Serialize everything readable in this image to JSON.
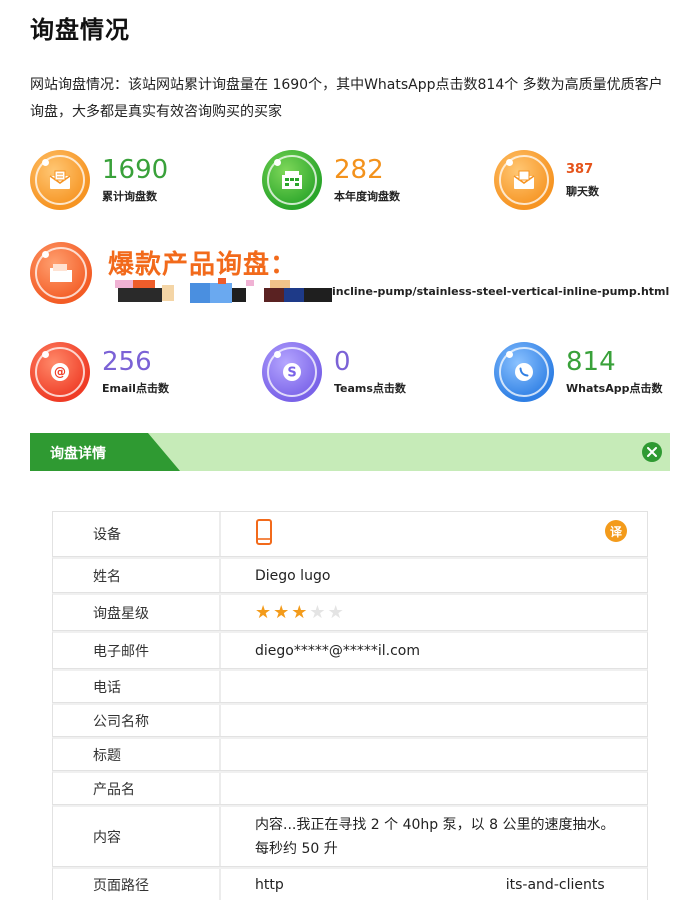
{
  "title": "询盘情况",
  "summary": "网站询盘情况：该站网站累计询盘量在 1690个，其中WhatsApp点击数814个 多数为高质量优质客户询盘，大多都是真实有效咨询购买的买家",
  "stats_row1": [
    {
      "value": "1690",
      "label": "累计询盘数",
      "icon": "mail-icon",
      "color": "#f69422"
    },
    {
      "value": "282",
      "label": "本年度询盘数",
      "icon": "building-icon",
      "color": "#2aa52a"
    },
    {
      "value": "387",
      "label": "聊天数",
      "icon": "chat-icon",
      "color": "#f69422"
    }
  ],
  "hot_product": {
    "title": "爆款产品询盘：",
    "link": "incline-pump/stainless-steel-vertical-inline-pump.html",
    "icon": "folder-icon"
  },
  "stats_row2": [
    {
      "value": "256",
      "label": "Email点击数",
      "icon": "at-icon",
      "color": "#ef3b25"
    },
    {
      "value": "0",
      "label": "Teams点击数",
      "icon": "skype-icon",
      "color": "#7a63e8"
    },
    {
      "value": "814",
      "label": "WhatsApp点击数",
      "icon": "whatsapp-icon",
      "color": "#2f7fe4"
    }
  ],
  "detail_bar": {
    "title": "询盘详情"
  },
  "table": {
    "translate_label": "译",
    "rows": [
      {
        "key": "设备",
        "value": ""
      },
      {
        "key": "姓名",
        "value": "Diego lugo"
      },
      {
        "key": "询盘星级",
        "value": "",
        "stars": 3,
        "max_stars": 5
      },
      {
        "key": "电子邮件",
        "value": "diego*****@*****il.com"
      },
      {
        "key": "电话",
        "value": ""
      },
      {
        "key": "公司名称",
        "value": ""
      },
      {
        "key": "标题",
        "value": ""
      },
      {
        "key": "产品名",
        "value": ""
      },
      {
        "key": "内容",
        "value": "内容...我正在寻找 2 个 40hp 泵，以 8 公里的速度抽水。每秒约 50 升"
      },
      {
        "key": "页面路径",
        "value_start": "http",
        "value_end": "its-and-clients"
      }
    ]
  }
}
